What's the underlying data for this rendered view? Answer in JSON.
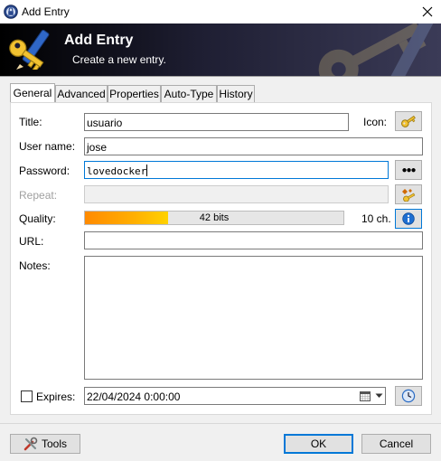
{
  "window": {
    "title": "Add Entry",
    "close_icon": "close-icon"
  },
  "banner": {
    "title": "Add Entry",
    "subtitle": "Create a new entry."
  },
  "tabs": [
    "General",
    "Advanced",
    "Properties",
    "Auto-Type",
    "History"
  ],
  "active_tab": "General",
  "form": {
    "title_label": "Title:",
    "title_value": "usuario",
    "icon_label": "Icon:",
    "username_label": "User name:",
    "username_value": "jose",
    "password_label": "Password:",
    "password_value": "lovedocker",
    "show_password_glyph": "●●●",
    "repeat_label": "Repeat:",
    "quality_label": "Quality:",
    "quality_text": "42 bits",
    "quality_fraction": 0.32,
    "quality_chars": "10 ch.",
    "url_label": "URL:",
    "url_value": "",
    "notes_label": "Notes:",
    "notes_value": "",
    "expires_label": "Expires:",
    "expires_checked": false,
    "expires_value": "22/04/2024  0:00:00"
  },
  "buttons": {
    "tools": "Tools",
    "ok": "OK",
    "cancel": "Cancel"
  },
  "colors": {
    "accent": "#0078d7",
    "quality_start": "#ff8a00",
    "quality_end": "#ffd200",
    "banner_dark": "#000000"
  }
}
